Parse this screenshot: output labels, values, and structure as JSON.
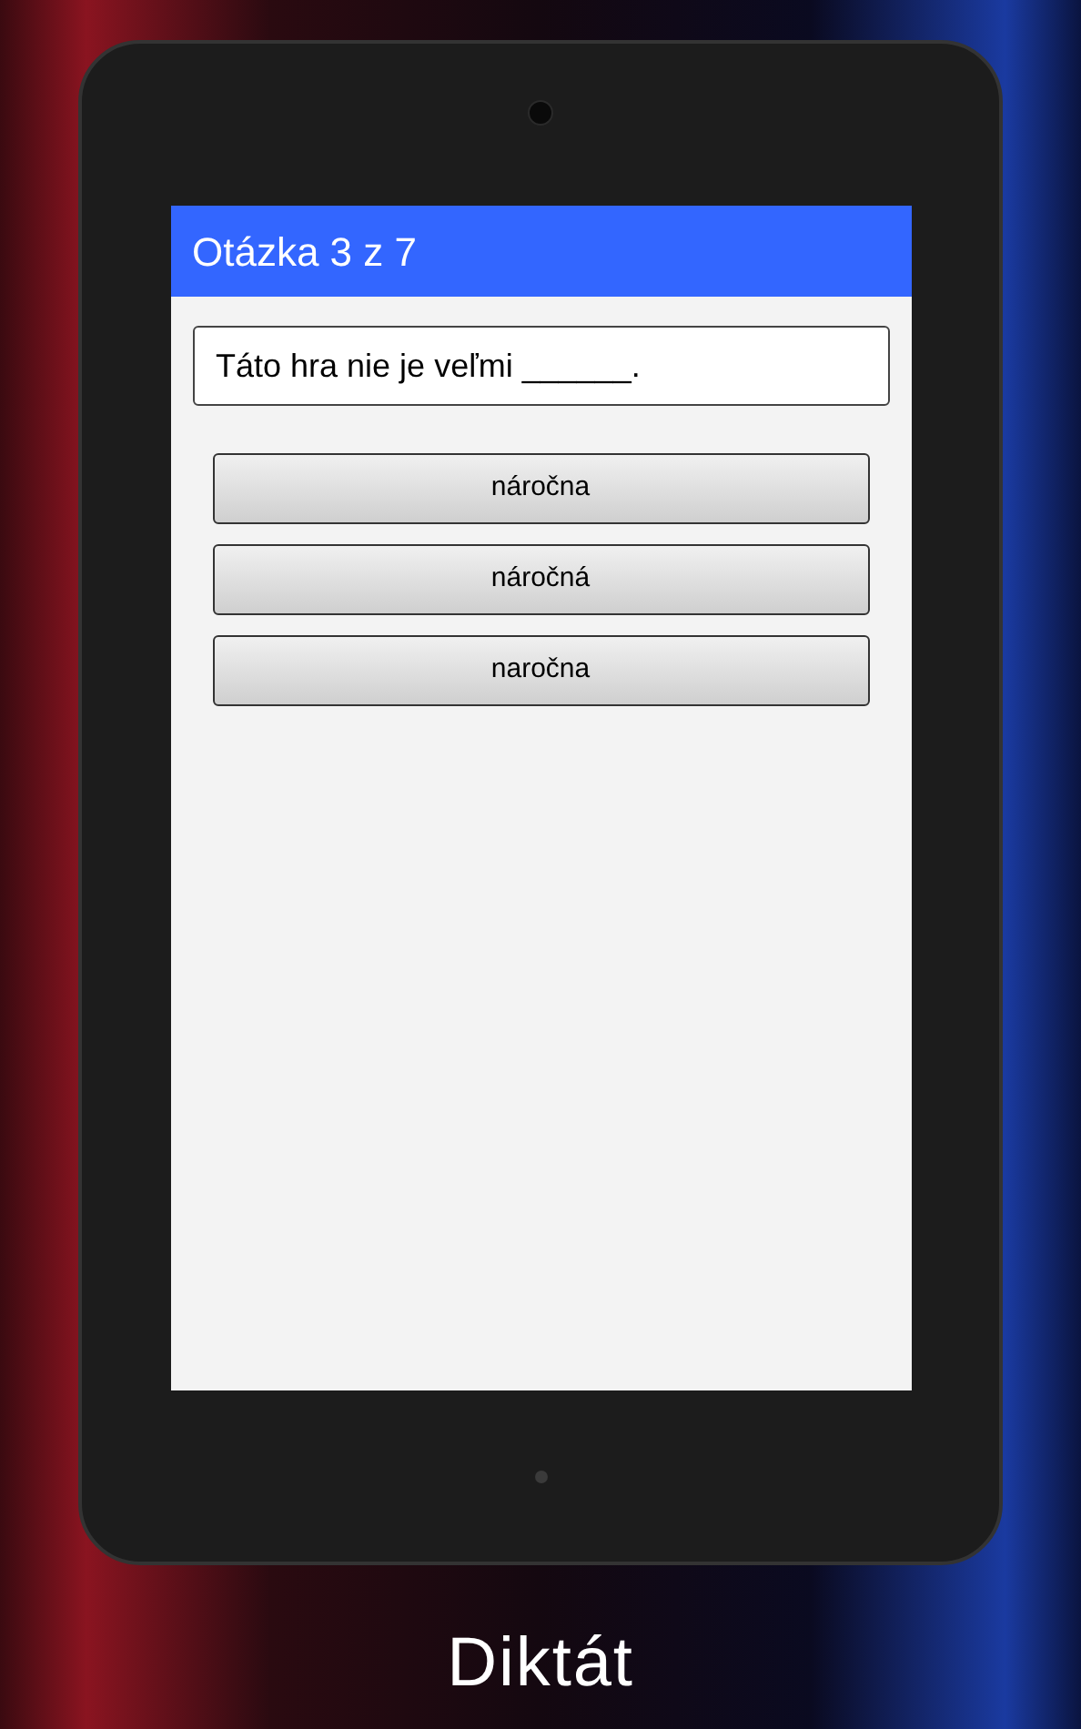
{
  "app_bar": {
    "title": "Otázka 3 z 7"
  },
  "question": "Táto hra nie je veľmi ______.",
  "answers": [
    "náročna",
    "náročná",
    "naročna"
  ],
  "caption": "Diktát"
}
